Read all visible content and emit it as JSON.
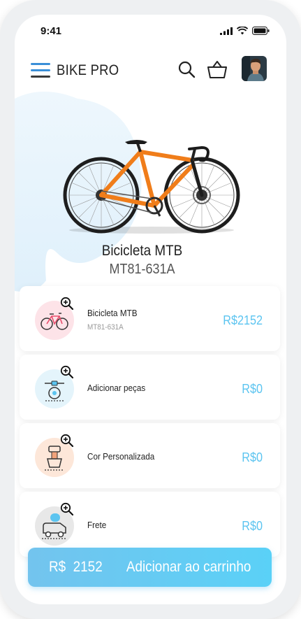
{
  "status_bar": {
    "time": "9:41"
  },
  "header": {
    "brand": "BIKE PRO",
    "menu_icon": "hamburger-menu-icon",
    "search_icon": "search-icon",
    "basket_icon": "basket-icon"
  },
  "colors": {
    "accent": "#5bc4f0",
    "menu_blue": "#3a8fd8",
    "bike_orange": "#f07d1a",
    "cta_start": "#73c4ee",
    "cta_end": "#5ad1f7"
  },
  "product": {
    "name": "Bicicleta MTB",
    "code": "MT81-631A"
  },
  "options": [
    {
      "title": "Bicicleta MTB",
      "subtitle": "MT81-631A",
      "price": "R$2152",
      "icon": "bicycle-icon"
    },
    {
      "title": "Adicionar peças",
      "price": "R$0",
      "icon": "bike-parts-icon"
    },
    {
      "title": "Cor Personalizada",
      "price": "R$0",
      "icon": "paint-roller-icon"
    },
    {
      "title": "Frete",
      "price": "R$0",
      "icon": "delivery-truck-icon"
    }
  ],
  "cta": {
    "price": "R$  2152",
    "label": "Adicionar ao carrinho"
  }
}
